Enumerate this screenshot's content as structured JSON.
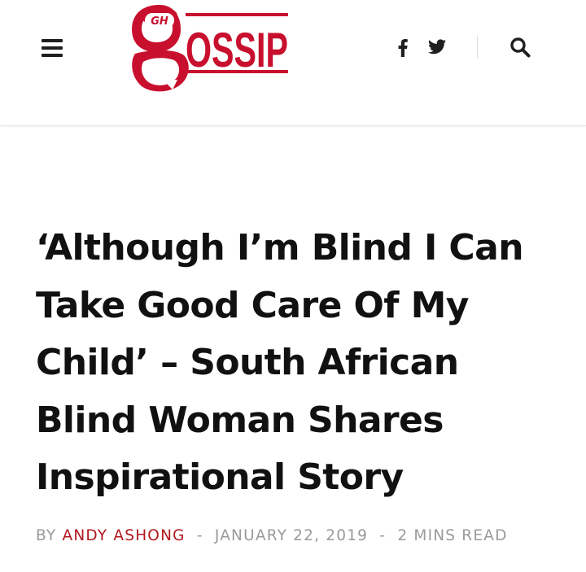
{
  "header": {
    "logo": {
      "badge_text": "GH",
      "wordmark": "OSSIP"
    },
    "social": [
      {
        "name": "facebook-icon"
      },
      {
        "name": "twitter-icon"
      }
    ],
    "search_icon": "search-icon",
    "menu_icon": "hamburger-menu-icon"
  },
  "article": {
    "title": "‘Although I’m Blind I Can Take Good Care Of My Child’ – South African Blind Woman Shares Inspirational Story",
    "byline": {
      "by_label": "BY",
      "author": "ANDY ASHONG",
      "separator": "-",
      "date": "JANUARY 22, 2019",
      "read_time": "2 MINS READ"
    }
  },
  "colors": {
    "brand_red": "#c8102e",
    "author_red": "#b0181e",
    "text_dark": "#111111",
    "meta_gray": "#9a9a9a"
  }
}
